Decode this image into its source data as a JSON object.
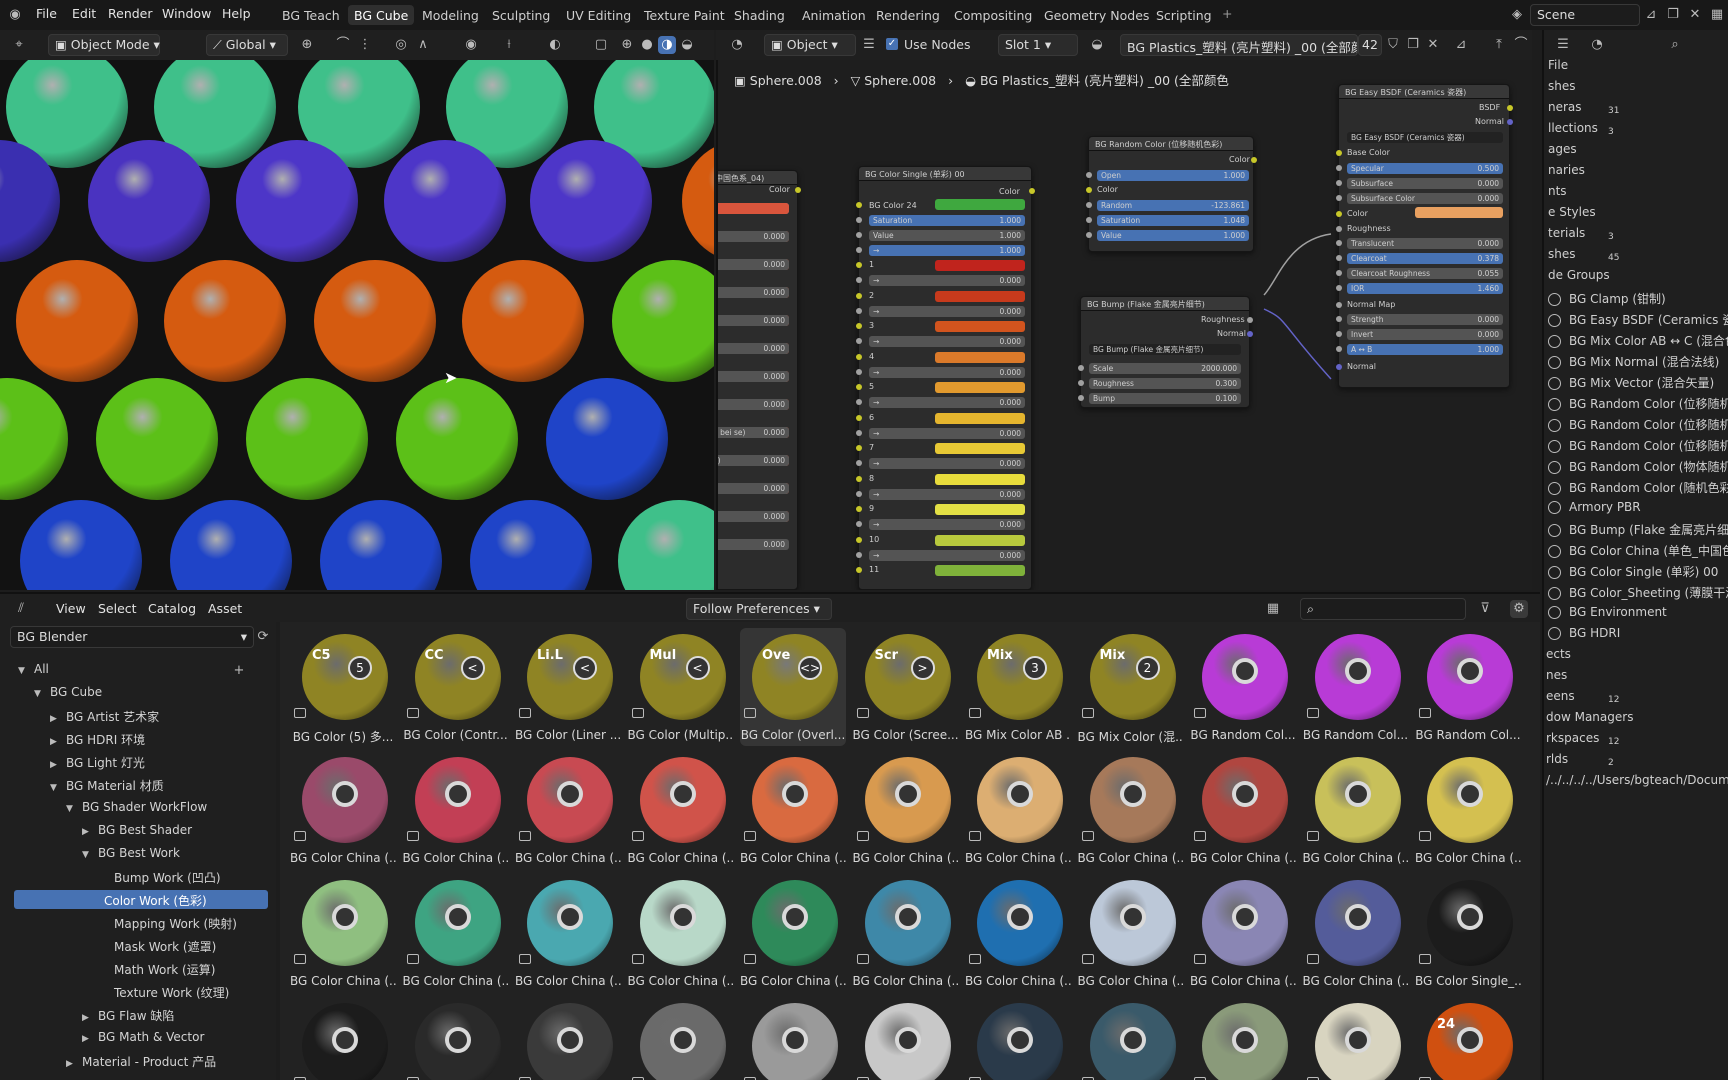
{
  "menu": [
    "File",
    "Edit",
    "Render",
    "Window",
    "Help"
  ],
  "workspaces": [
    "BG Teach",
    "BG Cube",
    "Modeling",
    "Sculpting",
    "UV Editing",
    "Texture Paint",
    "Shading",
    "Animation",
    "Rendering",
    "Compositing",
    "Geometry Nodes",
    "Scripting"
  ],
  "active_workspace": "BG Cube",
  "scene": "Scene",
  "viewport": {
    "mode": "Object Mode",
    "orientation": "Global"
  },
  "spheres": {
    "colors": [
      "#3fc08a",
      "#3fc08a",
      "#3fc08a",
      "#3fc08a",
      "#3fc08a",
      "#3a2fb0",
      "#4a33c0",
      "#4d36c8",
      "#4d36c8",
      "#4d36c8",
      "#d55b10",
      "#d55b10",
      "#d55b10",
      "#d55b10",
      "#d55b10",
      "#5cc018",
      "#5cc018",
      "#5cc018",
      "#5cc018",
      "#5cc018",
      "#1f44c8",
      "#1f44c8",
      "#1f44c8",
      "#1f44c8",
      "#1f44c8"
    ]
  },
  "node_header": {
    "object": "Object",
    "use_nodes": "Use Nodes",
    "slot": "Slot 1",
    "material": "BG Plastics_塑料 (亮片塑料) _00 (全部颜色",
    "users": "42"
  },
  "breadcrumb": [
    "Sphere.008",
    "Sphere.008",
    "BG Plastics_塑料 (亮片塑料) _00 (全部颜色"
  ],
  "nodes": {
    "partial": {
      "title": "中国色系_04)",
      "out": "Color",
      "first": "1.000",
      "values": [
        "0.000",
        "0.000",
        "0.000",
        "0.000",
        "0.000",
        "0.000",
        "0.000",
        "0.000",
        "0.000",
        "0.000",
        "0.000",
        "0.000"
      ],
      "labels": [
        "",
        ")",
        ")",
        "",
        "",
        "",
        "",
        "n bei se)",
        "e)",
        "",
        "",
        ""
      ]
    },
    "single": {
      "title": "BG Color Single (单彩) 00",
      "out": "Color",
      "color24": "BG Color 24",
      "saturation": "Saturation",
      "sat_val": "1.000",
      "value": "Value",
      "val_val": "1.000",
      "arrow_val": "1.000",
      "rows": [
        "1",
        "2",
        "3",
        "4",
        "5",
        "6",
        "7",
        "8",
        "9",
        "10",
        "11"
      ],
      "row_colors": [
        "#c0241d",
        "#c73a1c",
        "#d2541e",
        "#db7a2a",
        "#e29a2e",
        "#e5b52e",
        "#e8c935",
        "#e8dc3c",
        "#e3e045",
        "#b8c93d",
        "#7fb23a"
      ],
      "arrow": "→",
      "zero": "0.000"
    },
    "random": {
      "title": "BG Random Color (位移随机色彩)",
      "out": "Color",
      "open": "Open",
      "open_val": "1.000",
      "color": "Color",
      "random": "Random",
      "random_val": "-123.861",
      "saturation": "Saturation",
      "sat_val": "1.048",
      "value": "Value",
      "val_val": "1.000"
    },
    "bump": {
      "title": "BG Bump (Flake 金属亮片细节)",
      "out1": "Roughness",
      "out2": "Normal",
      "dd": "BG Bump (Flake 金属亮片细节)",
      "scale": "Scale",
      "scale_val": "2000.000",
      "rough": "Roughness",
      "rough_val": "0.300",
      "bump": "Bump",
      "bump_val": "0.100"
    },
    "easy": {
      "title": "BG Easy BSDF (Ceramics 瓷器)",
      "out1": "BSDF",
      "out2": "Normal",
      "dd": "BG Easy BSDF (Ceramics 瓷器)",
      "base": "Base Color",
      "rows": [
        [
          "Specular",
          "0.500",
          true
        ],
        [
          "Subsurface",
          "0.000",
          false
        ],
        [
          "Subsurface Color",
          "0.000",
          false
        ]
      ],
      "color": "Color",
      "rough": "Roughness",
      "rows2": [
        [
          "Translucent",
          "0.000",
          false
        ],
        [
          "Clearcoat",
          "0.378",
          true
        ],
        [
          "Clearcoat Roughness",
          "0.055",
          false
        ],
        [
          "IOR",
          "1.460",
          true
        ]
      ],
      "nmap": "Normal Map",
      "rows3": [
        [
          "Strength",
          "0.000",
          false
        ],
        [
          "Invert",
          "0.000",
          false
        ],
        [
          "A ↔ B",
          "1.000",
          true
        ]
      ],
      "normal": "Normal"
    }
  },
  "outliner": {
    "rows": [
      "File",
      "shes",
      "neras",
      "llections",
      "ages",
      "naries",
      "nts",
      "e Styles",
      "terials",
      "shes",
      "de Groups",
      "BG Clamp (钳制)",
      "BG Easy BSDF (Ceramics 瓷器",
      "BG Mix Color AB ↔ C (混合色",
      "BG Mix Normal (混合法线)",
      "BG Mix Vector (混合矢量)",
      "BG Random Color (位移随机色",
      "BG Random Color (位移随机色",
      "BG Random Color (位移随机色",
      "BG Random Color (物体随机色",
      "BG Random Color (随机色彩)",
      "Armory PBR",
      "BG Bump (Flake 金属亮片细节)",
      "BG Color China (单色_中国色",
      "BG Color Single (单彩) 00",
      "BG Color_Sheeting (薄膜干涉)",
      "BG Environment",
      "BG HDRI",
      "ects",
      "nes",
      "eens",
      "dow Managers",
      "rkspaces",
      "rlds",
      "/../../../../Users/bgteach/Documen"
    ],
    "counts": {
      "c1": "31",
      "c2": "3",
      "c3": "3",
      "c4": "45",
      "c5": "12",
      "c6": "12",
      "c7": "2"
    }
  },
  "asset_header": {
    "menus": [
      "View",
      "Select",
      "Catalog",
      "Asset"
    ],
    "import": "Follow Preferences",
    "library": "BG Blender"
  },
  "tree": [
    [
      "All",
      0,
      "open"
    ],
    [
      "BG Cube",
      1,
      "open"
    ],
    [
      "BG Artist 艺术家",
      2,
      "closed"
    ],
    [
      "BG HDRI 环境",
      2,
      "closed"
    ],
    [
      "BG Light 灯光",
      2,
      "closed"
    ],
    [
      "BG Material 材质",
      2,
      "open"
    ],
    [
      "BG Shader WorkFlow",
      3,
      "open"
    ],
    [
      "BG Best Shader",
      4,
      "closed"
    ],
    [
      "BG Best Work",
      4,
      "open"
    ],
    [
      "Bump Work (凹凸)",
      5,
      "none"
    ],
    [
      "Color Work (色彩)",
      5,
      "sel"
    ],
    [
      "Mapping Work (映射)",
      5,
      "none"
    ],
    [
      "Mask Work (遮罩)",
      5,
      "none"
    ],
    [
      "Math Work (运算)",
      5,
      "none"
    ],
    [
      "Texture Work (纹理)",
      5,
      "none"
    ],
    [
      "BG Flaw 缺陷",
      4,
      "closed"
    ],
    [
      "BG Math & Vector",
      4,
      "closed"
    ],
    [
      "Material - Product 产品",
      3,
      "closed"
    ]
  ],
  "assets": [
    [
      [
        "BG Color (5) 多...",
        "C5",
        "5",
        "#8f8424"
      ],
      [
        "BG Color (Contr...",
        "CC",
        "<",
        "#8f8424"
      ],
      [
        "BG Color (Liner ...",
        "Li.L",
        "<",
        "#8f8424"
      ],
      [
        "BG Color (Multip...",
        "Mul",
        "<",
        "#8f8424"
      ],
      [
        "BG Color (Overl...",
        "Ove",
        "<>",
        "#8f8424"
      ],
      [
        "BG Color (Scree...",
        "Scr",
        ">",
        "#8f8424"
      ],
      [
        "BG Mix Color AB ...",
        "Mix",
        "3",
        "#8f8424"
      ],
      [
        "BG Mix Color (混...",
        "Mix",
        "2",
        "#8f8424"
      ],
      [
        "BG Random Col...",
        "",
        "",
        "#b83bd6"
      ],
      [
        "BG Random Col...",
        "",
        "",
        "#b83bd6"
      ],
      [
        "BG Random Col...",
        "",
        "",
        "#b83bd6"
      ]
    ],
    [
      [
        "BG Color China (...",
        "",
        "",
        "#9a4a6a"
      ],
      [
        "BG Color China (...",
        "",
        "",
        "#c23f55"
      ],
      [
        "BG Color China (...",
        "",
        "",
        "#c84a52"
      ],
      [
        "BG Color China (...",
        "",
        "",
        "#d0534a"
      ],
      [
        "BG Color China (...",
        "",
        "",
        "#d96a40"
      ],
      [
        "BG Color China (...",
        "",
        "",
        "#d89a4f"
      ],
      [
        "BG Color China (...",
        "",
        "",
        "#dcae72"
      ],
      [
        "BG Color China (...",
        "",
        "",
        "#a6795a"
      ],
      [
        "BG Color China (...",
        "",
        "",
        "#b04640"
      ],
      [
        "BG Color China (...",
        "",
        "",
        "#c8c05a"
      ],
      [
        "BG Color China (...",
        "",
        "",
        "#d4c050"
      ]
    ],
    [
      [
        "BG Color China (...",
        "",
        "",
        "#8fbf80"
      ],
      [
        "BG Color China (...",
        "",
        "",
        "#3ea482"
      ],
      [
        "BG Color China (...",
        "",
        "",
        "#4aa8b0"
      ],
      [
        "BG Color China (...",
        "",
        "",
        "#b8d8c8"
      ],
      [
        "BG Color China (...",
        "",
        "",
        "#2e8a5a"
      ],
      [
        "BG Color China (...",
        "",
        "",
        "#3e88a8"
      ],
      [
        "BG Color China (...",
        "",
        "",
        "#1f6fb0"
      ],
      [
        "BG Color China (...",
        "",
        "",
        "#bcc8d8"
      ],
      [
        "BG Color China (...",
        "",
        "",
        "#8a86b4"
      ],
      [
        "BG Color China (...",
        "",
        "",
        "#545c9a"
      ],
      [
        "BG Color Single_...",
        "",
        "",
        "#1c1c1c"
      ]
    ],
    [
      [
        "",
        "",
        "",
        "#1c1c1c"
      ],
      [
        "",
        "",
        "",
        "#2a2a2a"
      ],
      [
        "",
        "",
        "",
        "#3a3a3a"
      ],
      [
        "",
        "",
        "",
        "#6a6a6a"
      ],
      [
        "",
        "",
        "",
        "#9a9a9a"
      ],
      [
        "",
        "",
        "",
        "#c8c8c8"
      ],
      [
        "",
        "",
        "",
        "#2a3a4a"
      ],
      [
        "",
        "",
        "",
        "#3a5a6a"
      ],
      [
        "",
        "",
        "",
        "#8a9a7a"
      ],
      [
        "",
        "",
        "",
        "#d8d4c0"
      ],
      [
        "",
        "24",
        "",
        "#d05010"
      ]
    ]
  ],
  "selected_asset_index": 4
}
